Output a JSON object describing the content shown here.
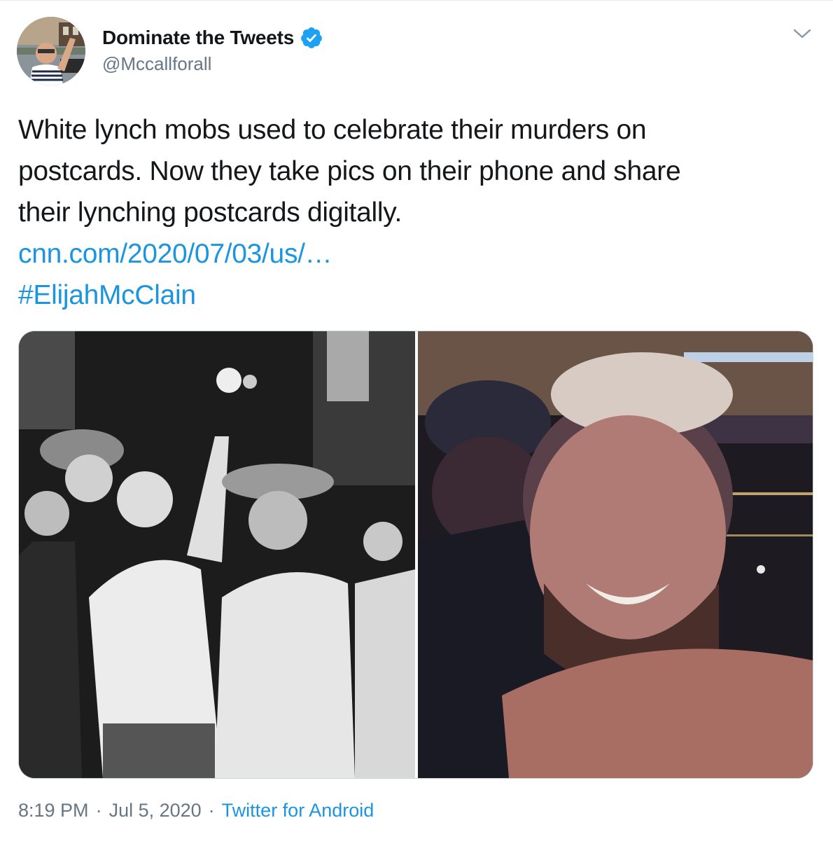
{
  "user": {
    "display_name": "Dominate the Tweets",
    "handle": "@Mccallforall",
    "verified": true,
    "avatar_icon": "profile-photo"
  },
  "tweet": {
    "text_lines": [
      "White lynch mobs used to celebrate their murders on",
      "postcards. Now they take pics on their phone and share",
      "their lynching postcards digitally."
    ],
    "link": "cnn.com/2020/07/03/us/…",
    "hashtag": "#ElijahMcClain"
  },
  "media": {
    "count": 2
  },
  "meta": {
    "time": "8:19 PM",
    "date": "Jul 5, 2020",
    "separator": "·",
    "source": "Twitter for Android"
  },
  "colors": {
    "link": "#1b95e0",
    "verified": "#1da1f2",
    "secondary_text": "#657786",
    "primary_text": "#14171a"
  }
}
